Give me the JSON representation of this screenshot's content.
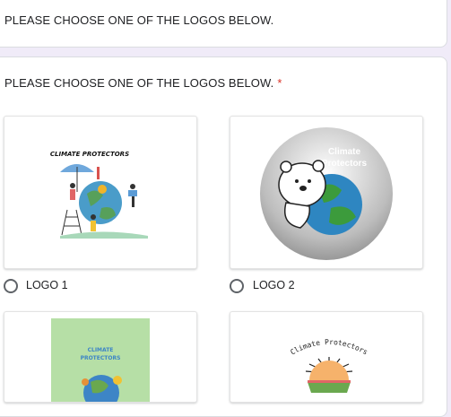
{
  "questions": [
    {
      "text": "PLEASE CHOOSE ONE OF THE LOGOS BELOW."
    },
    {
      "text": "PLEASE CHOOSE ONE OF THE LOGOS BELOW.",
      "required_mark": "*"
    }
  ],
  "options": [
    {
      "label": "LOGO 1",
      "image_text": "CLIMATE PROTECTORS",
      "selected": false
    },
    {
      "label": "LOGO 2",
      "image_text_line1": "Climate",
      "image_text_line2": "Protectors",
      "selected": false
    },
    {
      "label": "",
      "image_text_line1": "CLIMATE",
      "image_text_line2": "PROTECTORS"
    },
    {
      "label": "",
      "image_text": "Climate Protectors"
    }
  ],
  "colors": {
    "page_background": "#f0ebf8",
    "required": "#d93025",
    "radio_border": "#5f6368"
  },
  "icons": [
    "radio-unchecked-icon"
  ]
}
